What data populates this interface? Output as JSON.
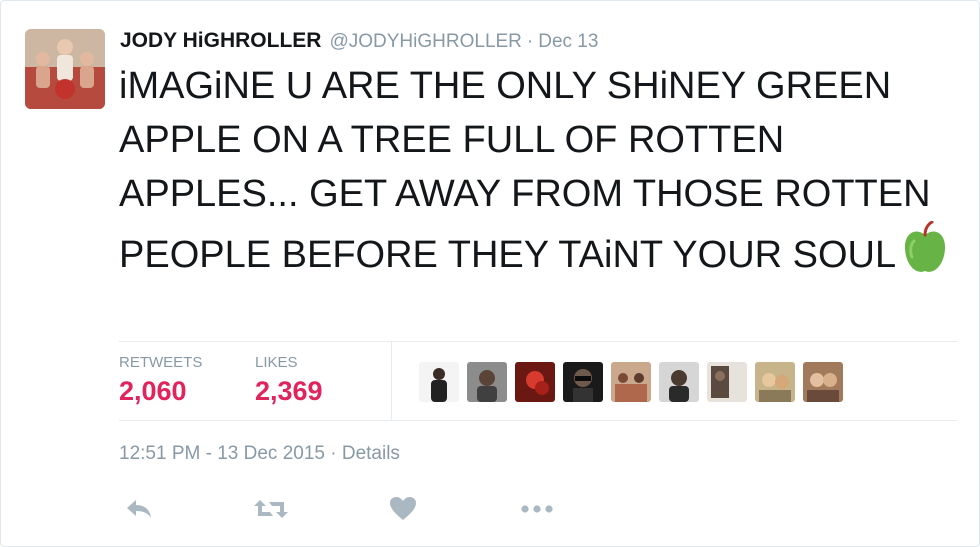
{
  "tweet": {
    "author_name": "JODY HiGHROLLER",
    "author_handle": "@JODYHiGHROLLER",
    "separator": "·",
    "date": "Dec 13",
    "text": "iMAGiNE U ARE THE ONLY SHiNEY GREEN APPLE ON A TREE FULL OF ROTTEN APPLES... GET AWAY FROM THOSE ROTTEN PEOPLE BEFORE THEY TAiNT YOUR SOUL",
    "emoji_icon": "green-apple-icon"
  },
  "stats": {
    "retweets_label": "RETWEETS",
    "retweets_count": "2,060",
    "likes_label": "LIKES",
    "likes_count": "2,369",
    "liker_avatar_count": 9
  },
  "timestamp": {
    "text": "12:51 PM - 13 Dec 2015 · Details"
  },
  "actions": {
    "icons": [
      "reply-icon",
      "retweet-icon",
      "like-heart-icon",
      "more-options-icon"
    ]
  },
  "colors": {
    "accent_count": "#e0245e",
    "muted": "#8899a6",
    "icon": "#aab8c2",
    "text": "#14171a",
    "apple_green": "#67b346"
  }
}
